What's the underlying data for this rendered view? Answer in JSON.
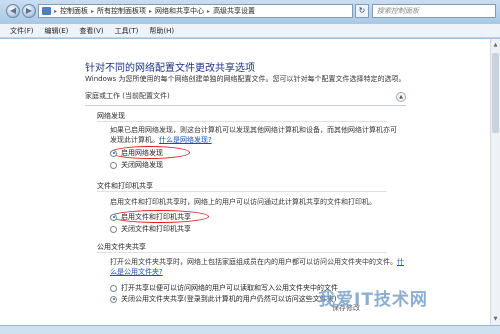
{
  "address": {
    "items": [
      "控制面板",
      "所有控制面板项",
      "网络和共享中心",
      "高级共享设置"
    ]
  },
  "search": {
    "placeholder": "搜索控制面板"
  },
  "menu": {
    "items": [
      "文件(F)",
      "编辑(E)",
      "查看(V)",
      "工具(T)",
      "帮助(H)"
    ]
  },
  "page": {
    "title": "针对不同的网络配置文件更改共享选项",
    "description": "Windows 为您所使用的每个网络创建单独的网络配置文件。您可以针对每个配置文件选择特定的选项。"
  },
  "profile": {
    "header": "家庭或工作 (当前配置文件)"
  },
  "sections": {
    "discovery": {
      "title": "网络发现",
      "para": "如果已启用网络发现，则这台计算机可以发现其他网络计算机和设备，而其他网络计算机亦可发现此计算机。",
      "link": "什么是网络发现?",
      "options": [
        "启用网络发现",
        "关闭网络发现"
      ]
    },
    "fileprint": {
      "title": "文件和打印机共享",
      "para": "启用文件和打印机共享时，网络上的用户可以访问通过此计算机共享的文件和打印机。",
      "options": [
        "启用文件和打印机共享",
        "关闭文件和打印机共享"
      ]
    },
    "public": {
      "title": "公用文件夹共享",
      "para": "打开公用文件夹共享时，网络上包括家庭组成员在内的用户都可以访问公用文件夹中的文件。",
      "link": "什么是公用文件夹?",
      "options": [
        "打开共享以便可以访问网络的用户可以读取和写入公用文件夹中的文件",
        "关闭公用文件夹共享(登录到此计算机的用户仍然可以访问这些文件夹)"
      ]
    }
  },
  "footer": {
    "save": "保存修改"
  },
  "watermark": "我爱IT技术网"
}
